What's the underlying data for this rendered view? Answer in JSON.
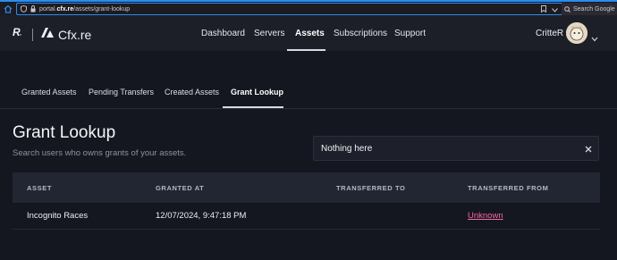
{
  "browser": {
    "url_prefix": "portal.",
    "url_host": "cfx.re",
    "url_path": "/assets/grant-lookup",
    "search_placeholder": "Search Google"
  },
  "nav": {
    "brand": "Cfx.re",
    "links": [
      "Dashboard",
      "Servers",
      "Assets",
      "Subscriptions",
      "Support"
    ],
    "active": "Assets",
    "username": "CritteR"
  },
  "tabs": {
    "items": [
      "Granted Assets",
      "Pending Transfers",
      "Created Assets",
      "Grant Lookup"
    ],
    "active": "Grant Lookup"
  },
  "page": {
    "title": "Grant Lookup",
    "subtitle": "Search users who owns grants of your assets.",
    "search_value": "Nothing here"
  },
  "table": {
    "headers": [
      "ASSET",
      "GRANTED AT",
      "TRANSFERRED TO",
      "TRANSFERRED FROM"
    ],
    "rows": [
      {
        "asset": "Incognito Races",
        "granted_at": "12/07/2024, 9:47:18 PM",
        "transferred_to": "",
        "transferred_from": "Unknown"
      }
    ]
  },
  "colors": {
    "accent_link": "#f26aa0",
    "background": "#151720",
    "browser_focus": "#2a8cf0"
  },
  "icons": {
    "home": "home-icon",
    "lock": "lock-icon",
    "bookmark": "bookmark-icon",
    "dropdown": "chevron-down-icon",
    "clear": "close-icon"
  }
}
